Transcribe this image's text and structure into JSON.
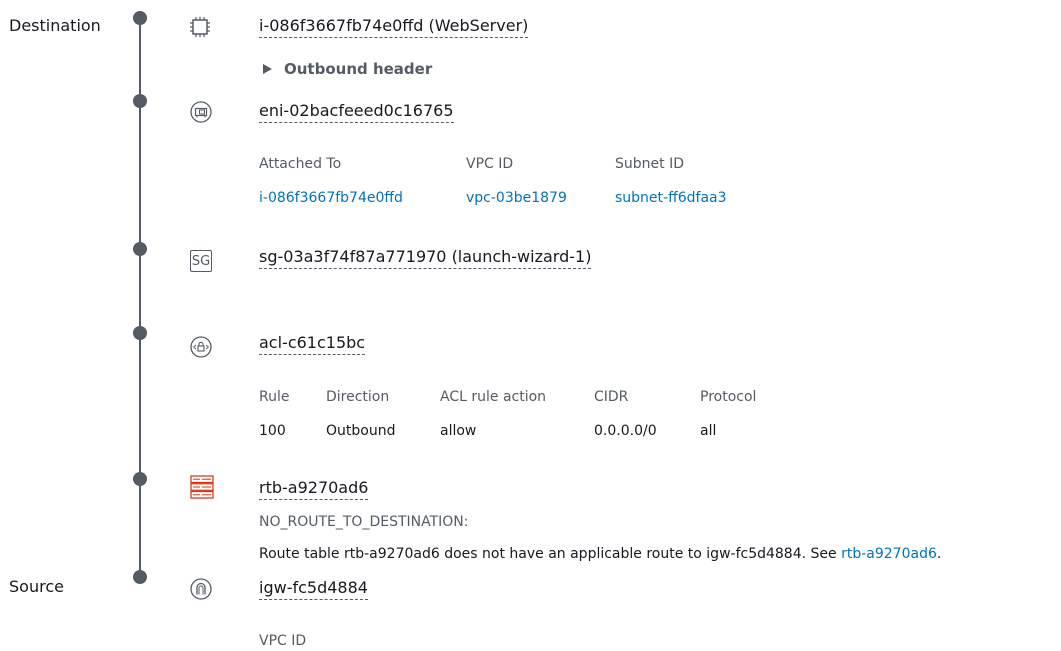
{
  "path": {
    "destination_label": "Destination",
    "source_label": "Source",
    "steps": {
      "instance": {
        "icon": "chip-icon",
        "title": "i-086f3667fb74e0ffd (WebServer)",
        "disclosure": "Outbound header"
      },
      "eni": {
        "icon": "network-interface-icon",
        "title": "eni-02bacfeeed0c16765",
        "headers": [
          "Attached To",
          "VPC ID",
          "Subnet ID"
        ],
        "values": [
          "i-086f3667fb74e0ffd",
          "vpc-03be1879",
          "subnet-ff6dfaa3"
        ]
      },
      "sg": {
        "icon": "security-group-icon",
        "icon_text": "SG",
        "title": "sg-03a3f74f87a771970 (launch-wizard-1)"
      },
      "acl": {
        "icon": "network-acl-icon",
        "title": "acl-c61c15bc",
        "headers": [
          "Rule",
          "Direction",
          "ACL rule action",
          "CIDR",
          "Protocol"
        ],
        "values": [
          "100",
          "Outbound",
          "allow",
          "0.0.0.0/0",
          "all"
        ]
      },
      "rtb": {
        "icon": "route-table-icon",
        "title": "rtb-a9270ad6",
        "error_code": "NO_ROUTE_TO_DESTINATION:",
        "message_prefix": "Route table rtb-a9270ad6 does not have an applicable route to igw-fc5d4884. See ",
        "message_link": "rtb-a9270ad6",
        "message_suffix": "."
      },
      "igw": {
        "icon": "internet-gateway-icon",
        "title": "igw-fc5d4884",
        "headers": [
          "VPC ID"
        ]
      }
    }
  },
  "colors": {
    "text": "#16191f",
    "muted": "#545b64",
    "link": "#0073bb",
    "route_table": "#d13212"
  }
}
